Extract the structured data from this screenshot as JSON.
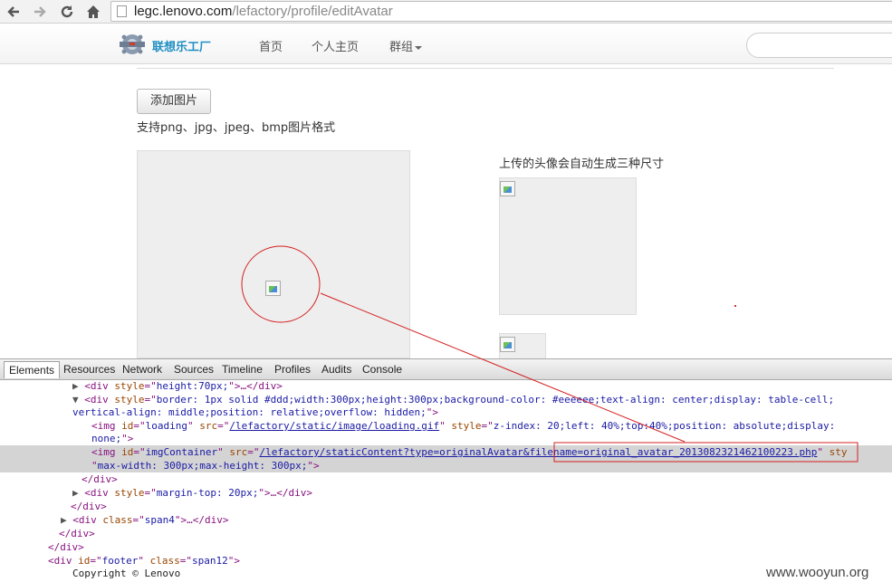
{
  "browser": {
    "url_host": "legc.lenovo.com",
    "url_path": "/lefactory/profile/editAvatar",
    "icons": [
      "back-arrow-icon",
      "forward-arrow-icon",
      "reload-icon",
      "home-icon",
      "page-icon"
    ]
  },
  "site": {
    "logo_text": "联想乐工厂",
    "nav": [
      {
        "label": "首页"
      },
      {
        "label": "个人主页"
      },
      {
        "label": "群组"
      }
    ],
    "search_placeholder": ""
  },
  "content": {
    "add_image_button": "添加图片",
    "format_hint": "支持png、jpg、jpeg、bmp图片格式",
    "sizes_hint": "上传的头像会自动生成三种尺寸"
  },
  "devtools": {
    "tabs": [
      "Elements",
      "Resources",
      "Network",
      "Sources",
      "Timeline",
      "Profiles",
      "Audits",
      "Console"
    ],
    "lines": {
      "l1_open": "<div ",
      "l1_attr": "style",
      "l1_eq": "=\"",
      "l1_val": "height:70px;",
      "l1_close": "\">…</div>",
      "l2_open": "<div ",
      "l2_attr": "style",
      "l2_val": "border: 1px solid #ddd;width:300px;height:300px;background-color: #eeeeee;text-align: center;display: table-cell;",
      "l3_val": "vertical-align: middle;position: relative;overflow: hidden;",
      "l3_close": "\">",
      "l4_open": "<img ",
      "l4_attr1": "id",
      "l4_val1": "loading",
      "l4_attr2": "src",
      "l4_link": "/lefactory/static/image/loading.gif",
      "l4_attr3": "style",
      "l4_val3": "z-index: 20;left: 40%;top:40%;position: absolute;display:",
      "l5_val": "none;",
      "l5_close": "\">",
      "l6_open": "<img ",
      "l6_attr1": "id",
      "l6_val1": "imgContainer",
      "l6_attr2": "src",
      "l6_link": "/lefactory/staticContent?type=originalAvatar&filename=original_avatar_2013082321462100223.php",
      "l6_attr3": "sty",
      "l7_val": "max-width: 300px;max-height: 300px;",
      "l7_close": "\">",
      "l8": "</div>",
      "l9_open": "<div ",
      "l9_attr": "style",
      "l9_val": "margin-top: 20px;",
      "l9_close": "\">…</div>",
      "l10": "</div>",
      "l11_open": "<div ",
      "l11_attr": "class",
      "l11_val": "span4",
      "l11_close": "\">…</div>",
      "l12": "</div>",
      "l13": "</div>",
      "l14_open": "<div ",
      "l14_attr1": "id",
      "l14_val1": "footer",
      "l14_attr2": "class",
      "l14_val2": "span12",
      "l14_close": "\">",
      "l15": "Copyright © Lenovo"
    }
  },
  "watermark": "www.wooyun.org",
  "colors": {
    "annotation_red": "#d42020",
    "link_blue": "#1a1aa6",
    "tag_purple": "#881280",
    "attr_brown": "#994500",
    "logo_blue": "#1f8fc4"
  }
}
